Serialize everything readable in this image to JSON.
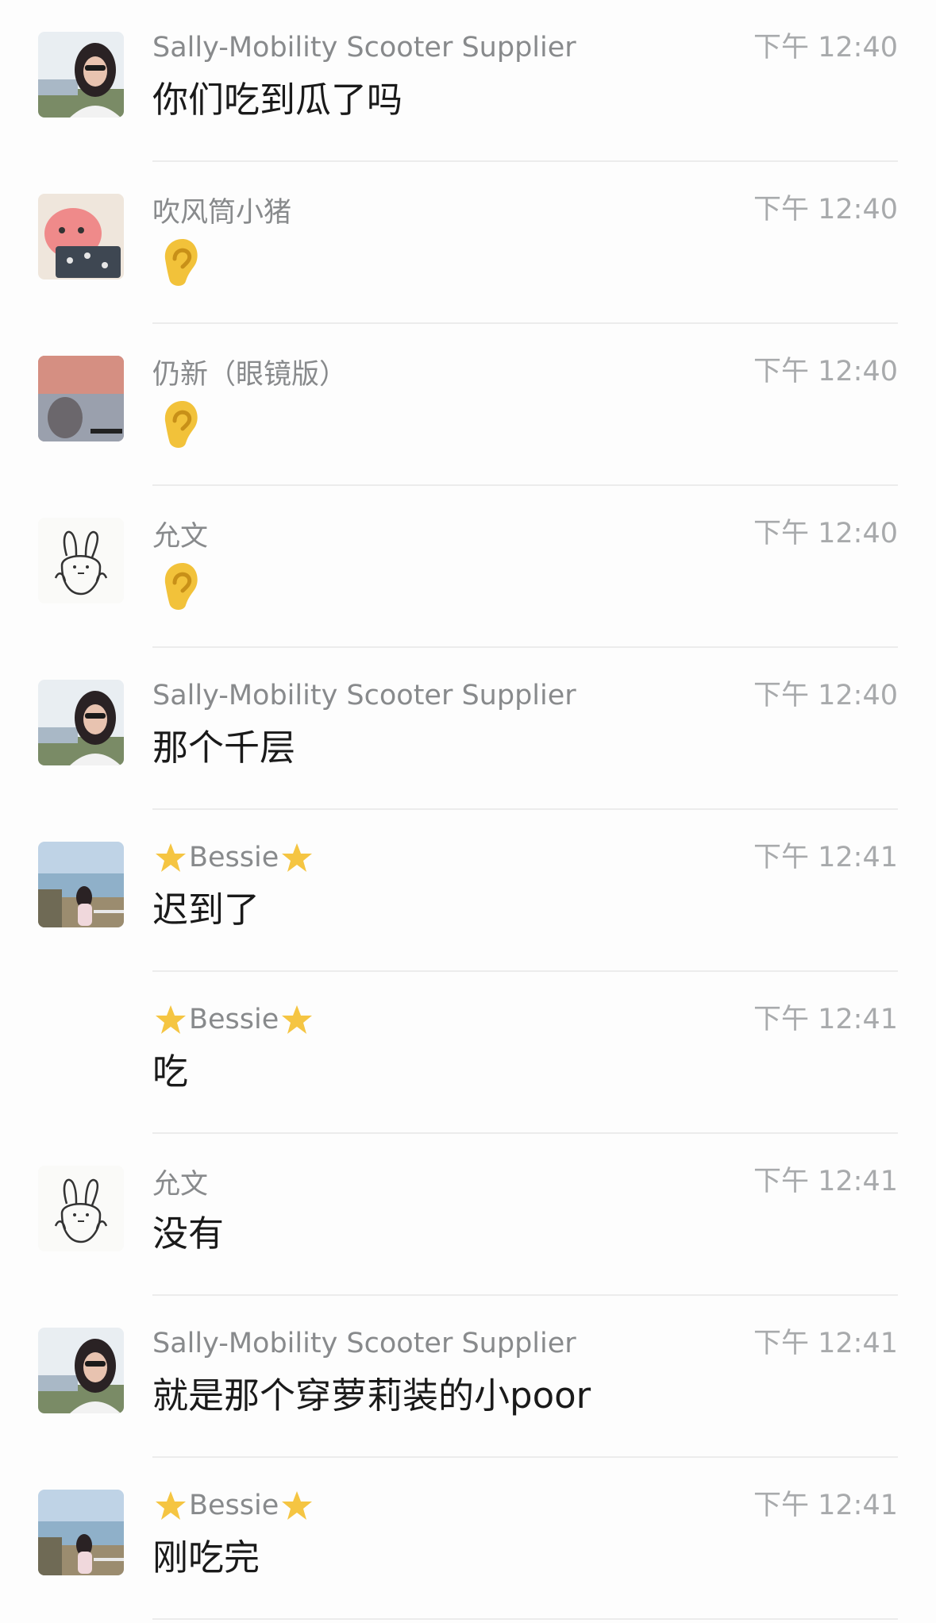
{
  "messages": [
    {
      "sender": "Sally-Mobility Scooter Supplier",
      "time": "下午 12:40",
      "text": "你们吃到瓜了吗",
      "avatar": "avatar-sally"
    },
    {
      "sender": "吹风筒小猪",
      "time": "下午 12:40",
      "text": "",
      "emoji": "ear-emoji",
      "avatar": "avatar-pig"
    },
    {
      "sender": "仍新（眼镜版）",
      "time": "下午 12:40",
      "text": "",
      "emoji": "ear-emoji",
      "avatar": "avatar-sunset"
    },
    {
      "sender": "允文",
      "time": "下午 12:40",
      "text": "",
      "emoji": "ear-emoji",
      "avatar": "avatar-rabbit"
    },
    {
      "sender": "Sally-Mobility Scooter Supplier",
      "time": "下午 12:40",
      "text": "那个千层",
      "avatar": "avatar-sally"
    },
    {
      "sender": "Bessie",
      "time": "下午 12:41",
      "text": "迟到了",
      "avatar": "avatar-bessie",
      "star_decor": true
    },
    {
      "sender": "Bessie",
      "time": "下午 12:41",
      "text": "吃",
      "avatar": "",
      "star_decor": true
    },
    {
      "sender": "允文",
      "time": "下午 12:41",
      "text": "没有",
      "avatar": "avatar-rabbit"
    },
    {
      "sender": "Sally-Mobility Scooter Supplier",
      "time": "下午 12:41",
      "text": "就是那个穿萝莉装的小poor",
      "avatar": "avatar-sally"
    },
    {
      "sender": "Bessie",
      "time": "下午 12:41",
      "text": "刚吃完",
      "avatar": "avatar-bessie",
      "star_decor": true
    }
  ],
  "colors": {
    "background": "#fdfdfd",
    "name": "#888a8c",
    "time": "#a8aaac",
    "message": "#1a1a1a",
    "divider": "#ececec"
  }
}
